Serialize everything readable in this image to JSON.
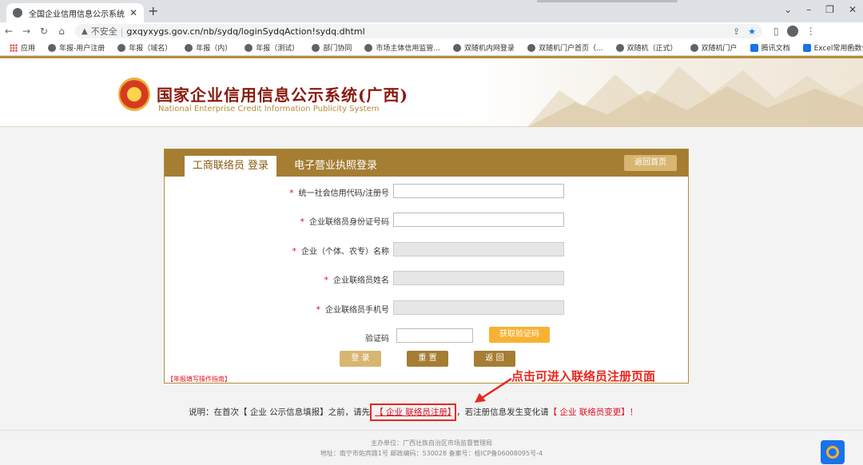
{
  "browser": {
    "tab_title": "全国企业信用信息公示系统",
    "tab_close": "✕",
    "new_tab": "+",
    "not_secure": "不安全",
    "url": "gxqyxygs.gov.cn/nb/sydq/loginSydqAction!sydq.dhtml",
    "bookmarks": [
      {
        "label": "应用",
        "icon": "apps-icon"
      },
      {
        "label": "年报-用户注册",
        "icon": "globe-icon"
      },
      {
        "label": "年报（域名）",
        "icon": "globe-icon"
      },
      {
        "label": "年报（内）",
        "icon": "globe-icon"
      },
      {
        "label": "年报（测试）",
        "icon": "globe-icon"
      },
      {
        "label": "部门协同",
        "icon": "globe-icon"
      },
      {
        "label": "市场主体信用监管...",
        "icon": "globe-icon"
      },
      {
        "label": "双随机内网登录",
        "icon": "globe-icon"
      },
      {
        "label": "双随机门户首页（...",
        "icon": "globe-icon"
      },
      {
        "label": "双随机（正式）",
        "icon": "globe-icon"
      },
      {
        "label": "双随机门户",
        "icon": "globe-icon"
      },
      {
        "label": "腾讯文档",
        "icon": "tencent-docs-icon"
      },
      {
        "label": "Excel常用函数公式...",
        "icon": "doc-icon"
      }
    ],
    "bookmarks_more": "»"
  },
  "header": {
    "title_cn": "国家企业信用信息公示系统(广西)",
    "title_en": "National Enterprise Credit Information Publicity System"
  },
  "login": {
    "tab_active": "工商联络员 登录",
    "tab_inactive": "电子营业执照登录",
    "home_button": "返回首页",
    "required_mark": "*",
    "fields": [
      {
        "label": "统一社会信用代码/注册号",
        "value": "",
        "readonly": false
      },
      {
        "label": "企业联络员身份证号码",
        "value": "",
        "readonly": false
      },
      {
        "label": "企业（个体、农专）名称",
        "value": "",
        "readonly": true
      },
      {
        "label": "企业联络员姓名",
        "value": "",
        "readonly": true
      },
      {
        "label": "企业联络员手机号",
        "value": "",
        "readonly": true
      }
    ],
    "captcha_label": "验证码",
    "get_code_button": "获取验证码",
    "login_button": "登 录",
    "reset_button": "重 置",
    "back_button": "返 回",
    "guide_link": "【年报填写操作指南】"
  },
  "annotation": "点击可进入联络员注册页面",
  "note": {
    "prefix": "说明：在首次【 企业 公示信息填报】之前，请先",
    "register_link": "【 企业 联络员注册】",
    "middle": "，若注册信息发生变化请",
    "change_link": "【 企业 联络员变更】！"
  },
  "footer": {
    "line1": "主办单位：广西壮族自治区市场监督管理局",
    "line2": "地址：南宁市佑宾路1号 邮政编码：530028   备案号：桂ICP备06008095号-4"
  },
  "colors": {
    "gold": "#a57d33",
    "red": "#d12",
    "accent": "#e8281c"
  }
}
